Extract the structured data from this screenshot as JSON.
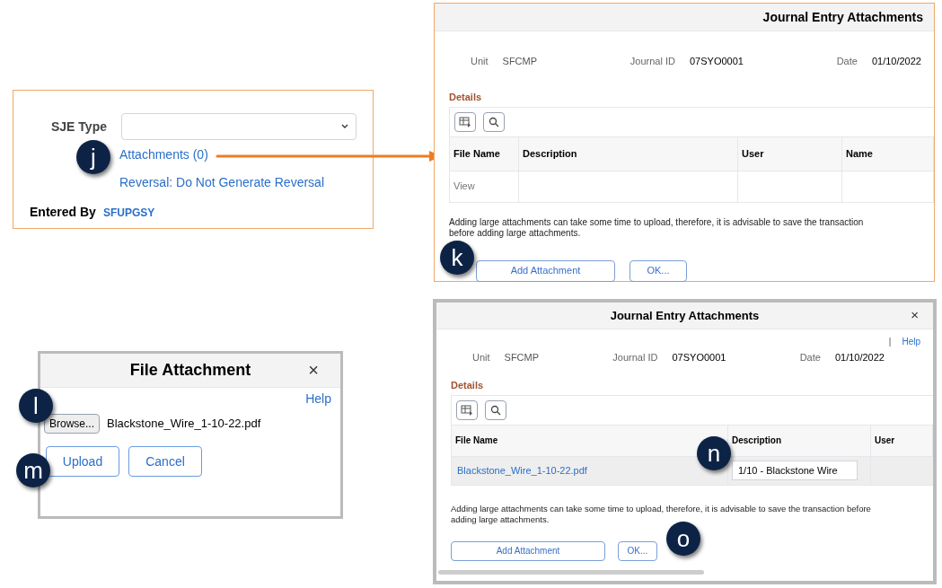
{
  "sje_panel": {
    "type_label": "SJE Type",
    "attachments_link": "Attachments (0)",
    "reversal_link": "Reversal: Do Not Generate Reversal",
    "entered_by_label": "Entered By",
    "entered_by_value": "SFUPGSY",
    "callout": "j"
  },
  "journal_entry_panel": {
    "title": "Journal Entry Attachments",
    "fields": [
      {
        "label": "Unit",
        "value": "SFCMP"
      },
      {
        "label": "Journal ID",
        "value": "07SYO0001"
      },
      {
        "label": "Date",
        "value": "01/10/2022"
      }
    ],
    "section": "Details",
    "columns": [
      "File Name",
      "Description",
      "User",
      "Name"
    ],
    "rows": [
      [
        "View",
        "",
        "",
        ""
      ]
    ],
    "note": "Adding large attachments can take some time to upload, therefore, it is advisable to save the transaction before adding large attachments.",
    "buttons": [
      "Add Attachment",
      "OK..."
    ],
    "callout": "k"
  },
  "file_attachment_dialog": {
    "title": "File Attachment",
    "close": "×",
    "help": "Help",
    "browse_button": "Browse...",
    "file_name": "Blackstone_Wire_1-10-22.pdf",
    "buttons": [
      "Upload",
      "Cancel"
    ],
    "callouts": [
      "l",
      "m"
    ]
  },
  "journal_entry_dialog": {
    "title": "Journal Entry Attachments",
    "close": "×",
    "separator": "|",
    "help": "Help",
    "fields": [
      {
        "label": "Unit",
        "value": "SFCMP"
      },
      {
        "label": "Journal ID",
        "value": "07SYO0001"
      },
      {
        "label": "Date",
        "value": "01/10/2022"
      }
    ],
    "section": "Details",
    "columns": [
      "File Name",
      "Description",
      "User"
    ],
    "rows": [
      {
        "file_name": "Blackstone_Wire_1-10-22.pdf",
        "description": "1/10 - Blackstone Wire"
      }
    ],
    "note": "Adding large attachments can take some time to upload, therefore, it is advisable to save the transaction before adding large attachments.",
    "buttons": [
      "Add Attachment",
      "OK..."
    ],
    "callouts": [
      "n",
      "o"
    ]
  }
}
